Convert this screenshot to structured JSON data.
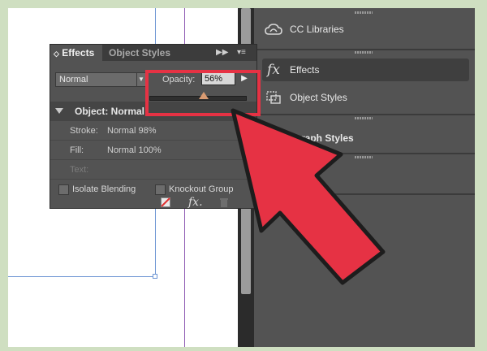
{
  "panel": {
    "tabs": [
      "Effects",
      "Object Styles"
    ],
    "blend_mode": "Normal",
    "opacity_label": "Opacity:",
    "opacity_value": "56%",
    "opacity_level": 0.56,
    "object_label": "Object: Normal",
    "rows": [
      {
        "key": "Stroke:",
        "value": "Normal 98%"
      },
      {
        "key": "Fill:",
        "value": "Normal 100%"
      },
      {
        "key": "Text:",
        "value": ""
      }
    ],
    "isolate_blending": "Isolate Blending",
    "knockout_group": "Knockout Group",
    "fx_button": "fx."
  },
  "dock": {
    "items": [
      {
        "label": "CC Libraries",
        "icon": "cc-libraries-icon"
      },
      {
        "label": "Effects",
        "icon": "fx-icon",
        "active": true
      },
      {
        "label": "Object Styles",
        "icon": "object-styles-icon"
      },
      {
        "label": "agraph Styles",
        "icon": "paragraph-styles-icon"
      }
    ]
  },
  "overlay": {
    "highlight_color": "#e63244",
    "arrow_color": "#e63244"
  }
}
